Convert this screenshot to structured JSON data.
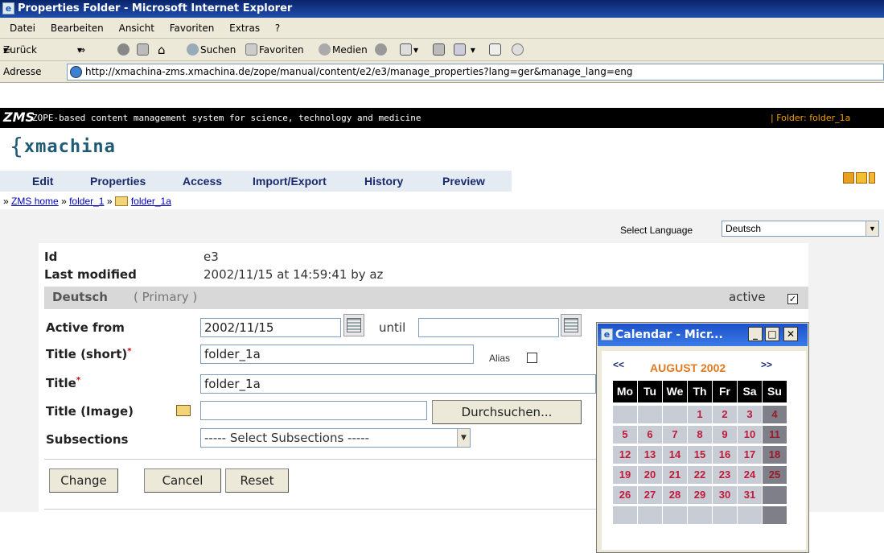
{
  "browser": {
    "title": "Properties Folder - Microsoft Internet Explorer",
    "menu": [
      "Datei",
      "Bearbeiten",
      "Ansicht",
      "Favoriten",
      "Extras",
      "?"
    ],
    "toolbar": {
      "back": "Zurück",
      "search": "Suchen",
      "favorites": "Favoriten",
      "media": "Medien"
    },
    "address_label": "Adresse",
    "address_url": "http://xmachina-zms.xmachina.de/zope/manual/content/e2/e3/manage_properties?lang=ger&manage_lang=eng"
  },
  "zms": {
    "logo": "ZMS",
    "description": "ZOPE-based content management system for science, technology and medicine",
    "context": "| Folder: folder_1a",
    "brand_brace": "{",
    "brand": "xmachina"
  },
  "tabs": [
    "Edit",
    "Properties",
    "Access",
    "Import/Export",
    "History",
    "Preview"
  ],
  "breadcrumb": {
    "home": "ZMS home",
    "sep": "»",
    "folder1": "folder_1",
    "folder1a": "folder_1a"
  },
  "language": {
    "label": "Select Language",
    "value": "Deutsch"
  },
  "form": {
    "id_label": "Id",
    "id_value": "e3",
    "modified_label": "Last modified",
    "modified_value": "2002/11/15 at 14:59:41 by az",
    "lang_name": "Deutsch",
    "lang_primary": "( Primary )",
    "active_label": "active",
    "active_checked": true,
    "active_from_label": "Active from",
    "active_from_value": "2002/11/15",
    "until_label": "until",
    "until_value": "",
    "title_short_label": "Title (short)",
    "title_short_value": "folder_1a",
    "alias_label": "Alias",
    "title_label": "Title",
    "title_value": "folder_1a",
    "title_image_label": "Title (Image)",
    "title_image_value": "",
    "browse_label": "Durchsuchen...",
    "subsections_label": "Subsections",
    "subsections_value": "----- Select Subsections -----",
    "required_mark": "*",
    "change": "Change",
    "cancel": "Cancel",
    "reset": "Reset"
  },
  "calendar": {
    "window_title": "Calendar - Micr...",
    "prev": "<<",
    "next": ">>",
    "month": "AUGUST 2002",
    "weekdays": [
      "Mo",
      "Tu",
      "We",
      "Th",
      "Fr",
      "Sa",
      "Su"
    ],
    "days": [
      "",
      "",
      "",
      "1",
      "2",
      "3",
      "4",
      "5",
      "6",
      "7",
      "8",
      "9",
      "10",
      "11",
      "12",
      "13",
      "14",
      "15",
      "16",
      "17",
      "18",
      "19",
      "20",
      "21",
      "22",
      "23",
      "24",
      "25",
      "26",
      "27",
      "28",
      "29",
      "30",
      "31",
      "",
      "",
      "",
      "",
      "",
      "",
      "",
      ""
    ]
  }
}
